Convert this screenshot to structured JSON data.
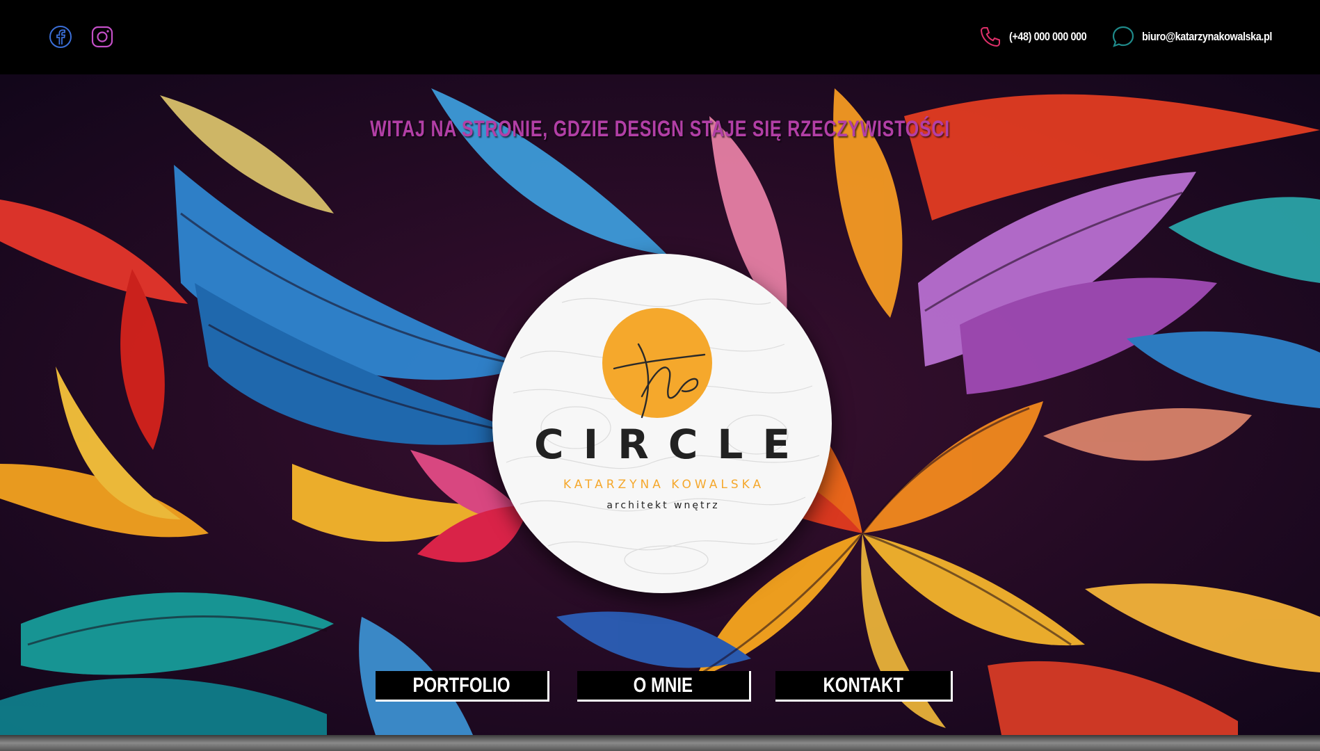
{
  "header": {
    "social": [
      {
        "icon": "facebook-icon",
        "color": "#3b6fd8"
      },
      {
        "icon": "instagram-icon",
        "color": "#c44fc7"
      }
    ],
    "phone": {
      "icon": "phone-icon",
      "color": "#e0306a",
      "text": "(+48) 000 000 000"
    },
    "email": {
      "icon": "chat-icon",
      "color": "#1f8a8a",
      "text": "biuro@katarzynakowalska.pl"
    }
  },
  "hero": {
    "headline": "WITAJ NA STRONIE, GDZIE DESIGN STAJE SIĘ RZECZYWISTOŚCI",
    "headline_color": "#b23fa6"
  },
  "logo": {
    "script": "the",
    "title": "CIRCLE",
    "name": "KATARZYNA KOWALSKA",
    "role": "architekt wnętrz",
    "accent": "#f5a82c"
  },
  "nav": {
    "items": [
      {
        "label": "PORTFOLIO"
      },
      {
        "label": "O MNIE"
      },
      {
        "label": "KONTAKT"
      }
    ]
  }
}
